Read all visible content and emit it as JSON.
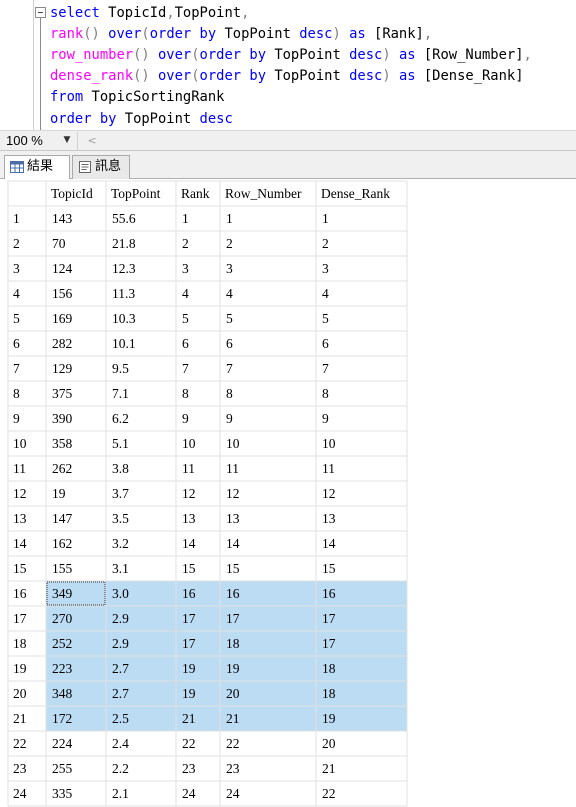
{
  "editor": {
    "lines": [
      [
        {
          "t": "select ",
          "c": "kw"
        },
        {
          "t": "TopicId",
          "c": "id"
        },
        {
          "t": ",",
          "c": "op"
        },
        {
          "t": "TopPoint",
          "c": "id"
        },
        {
          "t": ",",
          "c": "op"
        }
      ],
      [
        {
          "t": "rank",
          "c": "fn"
        },
        {
          "t": "() ",
          "c": "op"
        },
        {
          "t": "over",
          "c": "kw"
        },
        {
          "t": "(",
          "c": "op"
        },
        {
          "t": "order by ",
          "c": "kw"
        },
        {
          "t": "TopPoint ",
          "c": "id"
        },
        {
          "t": "desc",
          "c": "kw"
        },
        {
          "t": ") ",
          "c": "op"
        },
        {
          "t": "as ",
          "c": "kw"
        },
        {
          "t": "[Rank]",
          "c": "id"
        },
        {
          "t": ",",
          "c": "op"
        }
      ],
      [
        {
          "t": "row_number",
          "c": "fn"
        },
        {
          "t": "() ",
          "c": "op"
        },
        {
          "t": "over",
          "c": "kw"
        },
        {
          "t": "(",
          "c": "op"
        },
        {
          "t": "order by ",
          "c": "kw"
        },
        {
          "t": "TopPoint ",
          "c": "id"
        },
        {
          "t": "desc",
          "c": "kw"
        },
        {
          "t": ") ",
          "c": "op"
        },
        {
          "t": "as ",
          "c": "kw"
        },
        {
          "t": "[Row_Number]",
          "c": "id"
        },
        {
          "t": ",",
          "c": "op"
        }
      ],
      [
        {
          "t": "dense_rank",
          "c": "fn"
        },
        {
          "t": "() ",
          "c": "op"
        },
        {
          "t": "over",
          "c": "kw"
        },
        {
          "t": "(",
          "c": "op"
        },
        {
          "t": "order by ",
          "c": "kw"
        },
        {
          "t": "TopPoint ",
          "c": "id"
        },
        {
          "t": "desc",
          "c": "kw"
        },
        {
          "t": ") ",
          "c": "op"
        },
        {
          "t": "as ",
          "c": "kw"
        },
        {
          "t": "[Dense_Rank]",
          "c": "id"
        }
      ],
      [
        {
          "t": "from ",
          "c": "kw"
        },
        {
          "t": "TopicSortingRank",
          "c": "id"
        }
      ],
      [
        {
          "t": "order by ",
          "c": "kw"
        },
        {
          "t": "TopPoint ",
          "c": "id"
        },
        {
          "t": "desc",
          "c": "kw"
        }
      ]
    ]
  },
  "zoom": {
    "value": "100 %"
  },
  "tabs": {
    "results": "結果",
    "messages": "訊息"
  },
  "grid": {
    "columns": [
      "TopicId",
      "TopPoint",
      "Rank",
      "Row_Number",
      "Dense_Rank"
    ],
    "rows": [
      [
        "1",
        "143",
        "55.6",
        "1",
        "1",
        "1"
      ],
      [
        "2",
        "70",
        "21.8",
        "2",
        "2",
        "2"
      ],
      [
        "3",
        "124",
        "12.3",
        "3",
        "3",
        "3"
      ],
      [
        "4",
        "156",
        "11.3",
        "4",
        "4",
        "4"
      ],
      [
        "5",
        "169",
        "10.3",
        "5",
        "5",
        "5"
      ],
      [
        "6",
        "282",
        "10.1",
        "6",
        "6",
        "6"
      ],
      [
        "7",
        "129",
        "9.5",
        "7",
        "7",
        "7"
      ],
      [
        "8",
        "375",
        "7.1",
        "8",
        "8",
        "8"
      ],
      [
        "9",
        "390",
        "6.2",
        "9",
        "9",
        "9"
      ],
      [
        "10",
        "358",
        "5.1",
        "10",
        "10",
        "10"
      ],
      [
        "11",
        "262",
        "3.8",
        "11",
        "11",
        "11"
      ],
      [
        "12",
        "19",
        "3.7",
        "12",
        "12",
        "12"
      ],
      [
        "13",
        "147",
        "3.5",
        "13",
        "13",
        "13"
      ],
      [
        "14",
        "162",
        "3.2",
        "14",
        "14",
        "14"
      ],
      [
        "15",
        "155",
        "3.1",
        "15",
        "15",
        "15"
      ],
      [
        "16",
        "349",
        "3.0",
        "16",
        "16",
        "16"
      ],
      [
        "17",
        "270",
        "2.9",
        "17",
        "17",
        "17"
      ],
      [
        "18",
        "252",
        "2.9",
        "17",
        "18",
        "17"
      ],
      [
        "19",
        "223",
        "2.7",
        "19",
        "19",
        "18"
      ],
      [
        "20",
        "348",
        "2.7",
        "19",
        "20",
        "18"
      ],
      [
        "21",
        "172",
        "2.5",
        "21",
        "21",
        "19"
      ],
      [
        "22",
        "224",
        "2.4",
        "22",
        "22",
        "20"
      ],
      [
        "23",
        "255",
        "2.2",
        "23",
        "23",
        "21"
      ],
      [
        "24",
        "335",
        "2.1",
        "24",
        "24",
        "22"
      ]
    ],
    "selected_rows": [
      "16",
      "17",
      "18",
      "19",
      "20",
      "21"
    ],
    "active_cell": {
      "row": "16",
      "column": "TopicId"
    },
    "colors": {
      "selection": "#bcdcf4",
      "gridline": "#e0e0e0",
      "header_bg": "#ffffff"
    }
  }
}
